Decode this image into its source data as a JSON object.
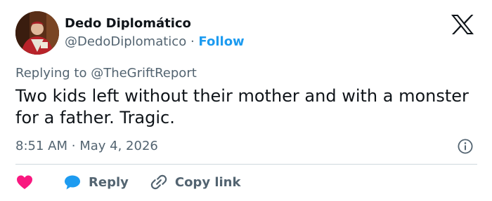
{
  "author": {
    "name": "Dedo Diplomático",
    "handle": "@DedoDiplomatico",
    "separator": "·",
    "follow_label": "Follow"
  },
  "reply_context": {
    "prefix": "Replying to ",
    "target": "@TheGriftReport"
  },
  "tweet": {
    "text": "Two kids left without their mother and with a monster for a father. Tragic.",
    "time": "8:51 AM",
    "separator": "·",
    "date": "May 4, 2026"
  },
  "actions": {
    "reply_label": "Reply",
    "copy_label": "Copy link"
  },
  "icons": {
    "brand": "x-logo-icon",
    "info": "info-icon",
    "like": "heart-icon",
    "reply": "reply-bubble-icon",
    "copy": "link-icon"
  },
  "colors": {
    "text_primary": "#0f1419",
    "text_secondary": "#536471",
    "accent": "#1d9bf0",
    "like": "#f91880",
    "divider": "#cfd9de"
  }
}
